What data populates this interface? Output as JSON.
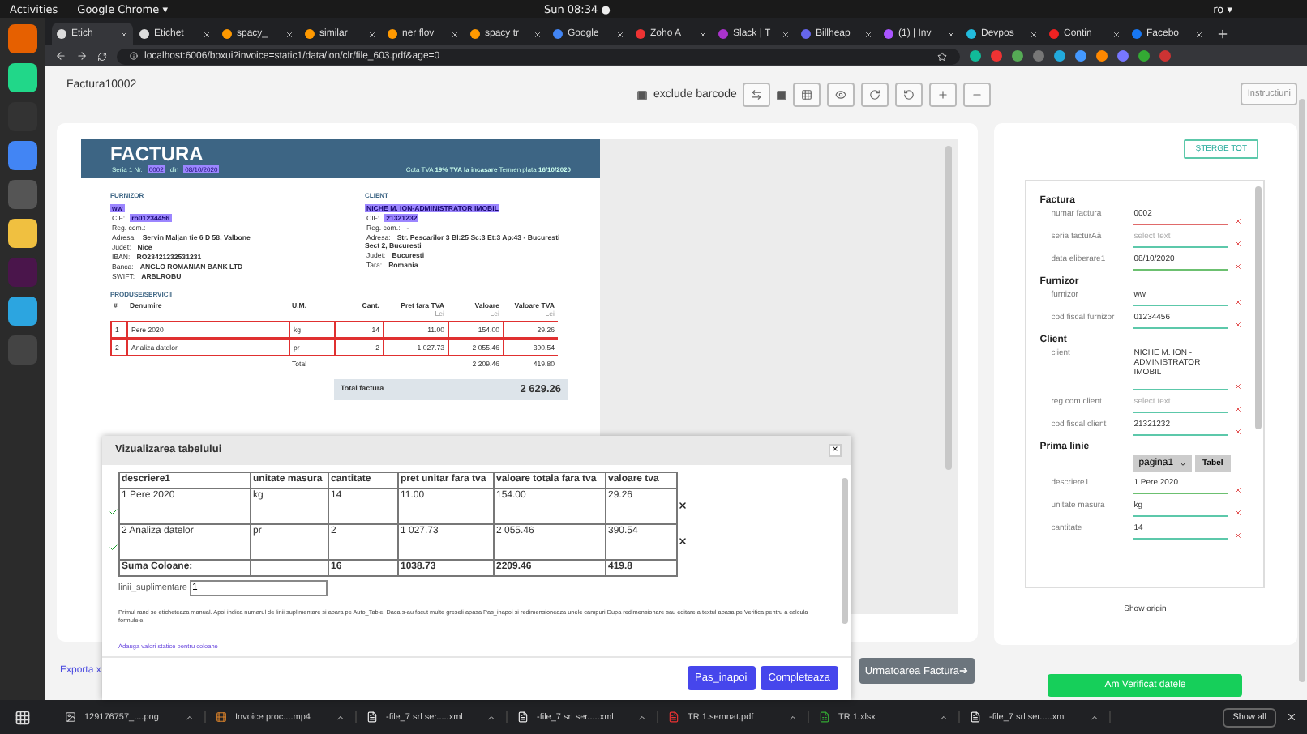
{
  "system_bar": {
    "activities": "Activities",
    "app": "Google Chrome ▾",
    "clock": "Sun 08:34 ●",
    "language": "ro ▾"
  },
  "tabs": [
    {
      "label": "Etich",
      "selected": true
    },
    {
      "label": "Etichet",
      "selected": false
    },
    {
      "label": "spacy_",
      "selected": false
    },
    {
      "label": "similar",
      "selected": false
    },
    {
      "label": "ner flov",
      "selected": false
    },
    {
      "label": "spacy tr",
      "selected": false
    },
    {
      "label": "Google",
      "selected": false
    },
    {
      "label": "Zoho A",
      "selected": false
    },
    {
      "label": "Slack | T",
      "selected": false
    },
    {
      "label": "Billheap",
      "selected": false
    },
    {
      "label": "(1) | Inv",
      "selected": false
    },
    {
      "label": "Devpos",
      "selected": false
    },
    {
      "label": "Contin",
      "selected": false
    },
    {
      "label": "Facebo",
      "selected": false
    }
  ],
  "address_bar": {
    "url": "localhost:6006/boxui?invoice=static1/data/ion/clr/file_603.pdf&age=0"
  },
  "page": {
    "title": "Factura10002",
    "exclude_barcode": {
      "label": "exclude barcode",
      "checked": true
    },
    "grid_toggle": {
      "checked": true
    },
    "help_button": "Instructiuni"
  },
  "invoice": {
    "title": "FACTURA",
    "meta_left": [
      {
        "text": "Seria 1 Nr.",
        "highlighted": false
      },
      {
        "text": "0002",
        "highlighted": true
      },
      {
        "text": "din",
        "highlighted": false
      },
      {
        "text": "08/10/2020",
        "highlighted": true
      }
    ],
    "meta_right": "Cota TVA **19%**   **TVA la incasare**   Termen plata **16/10/2020**",
    "parties": [
      {
        "heading": "FURNIZOR",
        "lines": [
          {
            "value": "ww",
            "highlighted": true
          },
          {
            "label": "CIF:",
            "value": "ro01234456",
            "highlighted": true
          },
          {
            "label": "Reg. com.:",
            "highlighted": false
          },
          {
            "label": "Adresa:",
            "value": "Servin Maljan tie 6 D 58, Valbone",
            "highlighted": false
          },
          {
            "label": "Judet:",
            "value": "Nice",
            "highlighted": false
          },
          {
            "label": "IBAN:",
            "value": "RO23421232531231",
            "highlighted": false
          },
          {
            "label": "Banca:",
            "value": "ANGLO ROMANIAN BANK LTD",
            "highlighted": false
          },
          {
            "label": "SWIFT:",
            "value": "ARBLROBU",
            "highlighted": false
          }
        ]
      },
      {
        "heading": "CLIENT",
        "lines": [
          {
            "value": "NICHE M. ION-ADMINISTRATOR IMOBIL",
            "highlighted": true
          },
          {
            "label": "CIF:",
            "value": "21321232",
            "highlighted": true
          },
          {
            "label": "Reg. com.:",
            "value": "-",
            "highlighted": false
          },
          {
            "label": "Adresa:",
            "value": "Str. Pescarilor 3 Bl:25 Sc:3 Et:3 Ap:43 - Bucuresti Sect 2, Bucuresti",
            "highlighted": false
          },
          {
            "label": "Judet:",
            "value": "Bucuresti",
            "highlighted": false
          },
          {
            "label": "Tara:",
            "value": "Romania",
            "highlighted": false
          }
        ]
      }
    ],
    "products_heading": "PRODUSE/SERVICII",
    "columns": [
      {
        "label": "#"
      },
      {
        "label": "Denumire"
      },
      {
        "label": "U.M."
      },
      {
        "label": "Cant."
      },
      {
        "label": "Pret fara TVA",
        "unit": "Lei"
      },
      {
        "label": "Valoare",
        "unit": "Lei"
      },
      {
        "label": "Valoare TVA",
        "unit": "Lei"
      }
    ],
    "rows": [
      [
        "1",
        "Pere 2020",
        "kg",
        "14",
        "11.00",
        "154.00",
        "29.26"
      ],
      [
        "2",
        "Analiza datelor",
        "pr",
        "2",
        "1 027.73",
        "2 055.46",
        "390.54"
      ]
    ],
    "total": {
      "label": "Total",
      "value": "2 209.46",
      "vat": "419.80"
    },
    "grand_total": {
      "label": "Total factura",
      "value": "2 629.26"
    }
  },
  "dialog": {
    "title": "Vizualizarea tabelului",
    "close": "×",
    "columns": [
      "descriere1",
      "unitate masura",
      "cantitate",
      "pret unitar fara tva",
      "valoare totala fara tva",
      "valoare tva"
    ],
    "rows": [
      {
        "checked": true,
        "cells": [
          "1 Pere 2020",
          "kg",
          "14",
          "11.00",
          "154.00",
          "29.26"
        ]
      },
      {
        "checked": true,
        "cells": [
          "2 Analiza datelor",
          "pr",
          "2",
          "1 027.73",
          "2 055.46",
          "390.54"
        ]
      }
    ],
    "sum_row": {
      "label": "Suma Coloane:",
      "values": [
        "16",
        "1038.73",
        "2209.46",
        "419.8"
      ]
    },
    "extra_lines": {
      "label": "linii_suplimentare",
      "value": "1"
    },
    "help": "Primul rand se eticheteaza manual. Apoi indica numarul de linii suplimentare si apara pe Auto_Table. Daca s-au facut multe greseli apasa Pas_inapoi si redimensioneaza unele campuri.Dupa redimensionare sau editare a textul apasa pe Verifica pentru a calcula formulele.",
    "link": "Adauga valori statice pentru coloane",
    "buttons": [
      "Pas_inapoi",
      "Completeaza"
    ]
  },
  "export_link": "Exporta x",
  "next_button": "Urmatoarea Factura➔",
  "form": {
    "clear_button": "ȘTERGE TOT",
    "sections": [
      {
        "title": "Factura",
        "fields": [
          {
            "kind": "field",
            "label": "numar factura",
            "value": "0002",
            "color": "#e06a6a"
          },
          {
            "kind": "field",
            "label": "seria facturAă",
            "placeholder": "select text",
            "color": "#5cc8aa"
          },
          {
            "kind": "field",
            "label": "data eliberare1",
            "value": "08/10/2020",
            "color": "#6cc070"
          }
        ]
      },
      {
        "title": "Furnizor",
        "fields": [
          {
            "kind": "field",
            "label": "furnizor",
            "value": "ww",
            "color": "#5cc8aa"
          },
          {
            "kind": "field",
            "label": "cod fiscal furnizor",
            "value": "01234456",
            "color": "#5cc8aa"
          }
        ]
      },
      {
        "title": "Client",
        "fields": [
          {
            "kind": "tall",
            "label": "client",
            "value": "NICHE M. ION - ADMINISTRATOR IMOBIL",
            "color": "#5cc8aa"
          },
          {
            "kind": "field",
            "label": "reg com client",
            "placeholder": "select text",
            "color": "#5cc8aa"
          },
          {
            "kind": "field",
            "label": "cod fiscal client",
            "value": "21321232",
            "color": "#5cc8aa"
          }
        ]
      },
      {
        "title": "Prima linie",
        "fields": [
          {
            "kind": "picker",
            "value": "pagina1",
            "button": "Tabel"
          },
          {
            "kind": "field",
            "label": "descriere1",
            "value": "1 Pere 2020",
            "color": "#6cc070"
          },
          {
            "kind": "field",
            "label": "unitate masura",
            "value": "kg",
            "color": "#5cc8aa"
          },
          {
            "kind": "field",
            "label": "cantitate",
            "value": "14",
            "color": "#5cc8aa"
          }
        ]
      }
    ],
    "show_origin": "Show origin"
  },
  "verify_button": "Am Verificat datele",
  "downloads": [
    {
      "kind": "image",
      "name": "129176757_....png"
    },
    {
      "kind": "video",
      "name": "Invoice proc....mp4"
    },
    {
      "kind": "file",
      "name": "-file_7 srl ser.....xml"
    },
    {
      "kind": "file",
      "name": "-file_7 srl ser.....xml"
    },
    {
      "kind": "pdf",
      "name": "TR 1.semnat.pdf"
    },
    {
      "kind": "sheet",
      "name": "TR 1.xlsx"
    },
    {
      "kind": "file",
      "name": "-file_7 srl ser.....xml"
    }
  ],
  "show_all": "Show all"
}
